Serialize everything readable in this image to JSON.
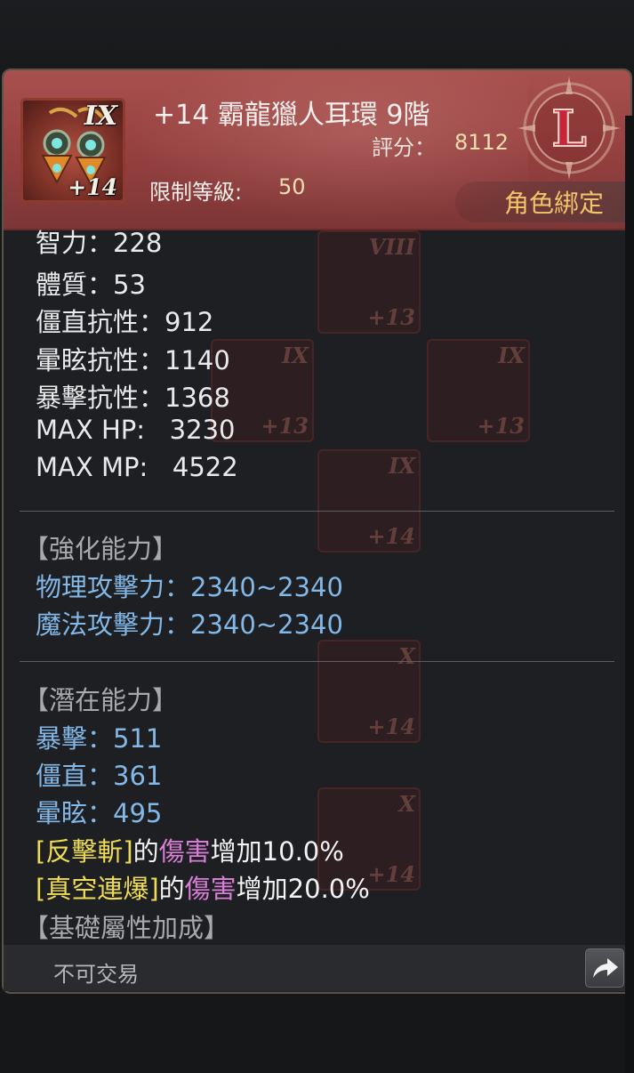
{
  "item": {
    "tier_roman": "IX",
    "enhance": "+14",
    "name": "+14 霸龍獵人耳環 9階",
    "score_label": "評分：",
    "score": "8112",
    "level_label": "限制等級:",
    "level": "50",
    "grade": "L",
    "binding": "角色綁定"
  },
  "base_stats": [
    {
      "label": "智力：228"
    },
    {
      "label": "體質：53"
    },
    {
      "label": "僵直抗性：912"
    },
    {
      "label": "暈眩抗性：1140"
    },
    {
      "label": "暴擊抗性：1368"
    },
    {
      "label": "MAX HP:   3230"
    },
    {
      "label": "MAX MP:   4522"
    }
  ],
  "enhance_section": {
    "title": "【強化能力】",
    "stats": [
      "物理攻擊力：2340~2340",
      "魔法攻擊力：2340~2340"
    ]
  },
  "potential_section": {
    "title": "【潛在能力】",
    "stats": [
      "暴擊：511",
      "僵直：361",
      "暈眩：495"
    ],
    "effects": [
      {
        "skill": "[反擊斬]",
        "of": "的",
        "target": "傷害",
        "rest": "增加10.0%"
      },
      {
        "skill": "[真空連爆]",
        "of": "的",
        "target": "傷害",
        "rest": "增加20.0%"
      }
    ]
  },
  "base_attr_title": "【基礎屬性加成】",
  "footer": {
    "trade": "不可交易",
    "share_icon": "share-arrow-icon"
  },
  "background_items": [
    {
      "tier": "VIII",
      "enhance": "+13"
    },
    {
      "tier": "IX",
      "enhance": "+13"
    },
    {
      "tier": "IX",
      "enhance": "+13"
    },
    {
      "tier": "IX",
      "enhance": "+14"
    },
    {
      "tier": "X",
      "enhance": "+14"
    },
    {
      "tier": "X",
      "enhance": "+14"
    }
  ],
  "colors": {
    "header": "#a04a48",
    "grade_letter": "#c8243a",
    "binding_text": "#f2c56b",
    "stat_blue": "#83b7e6",
    "skill_yellow": "#efdc55",
    "damage_pink": "#d87ed6"
  }
}
